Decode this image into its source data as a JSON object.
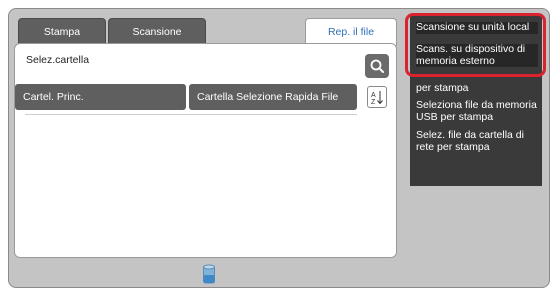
{
  "tabs": [
    {
      "label": "Stampa"
    },
    {
      "label": "Scansione"
    },
    {
      "label": "Rep. il file"
    }
  ],
  "panel": {
    "title": "Selez.cartella",
    "folders": [
      {
        "label": "Cartel. Princ."
      },
      {
        "label": "Cartella Selezione Rapida File"
      }
    ],
    "search_icon": "search-icon",
    "sort_icon": "sort-az-icon"
  },
  "sidebar": {
    "items": [
      {
        "label": "Scansione su unità local"
      },
      {
        "label": "Scans. su dispositivo di memoria esterno"
      },
      {
        "label": "per stampa"
      },
      {
        "label": "Seleziona file da memoria USB per stampa"
      },
      {
        "label": "Selez. file da cartella di rete per stampa"
      }
    ]
  },
  "colors": {
    "highlight": "#d9232e",
    "active_tab_text": "#2f6fb8"
  },
  "status_icon": "storage-icon"
}
